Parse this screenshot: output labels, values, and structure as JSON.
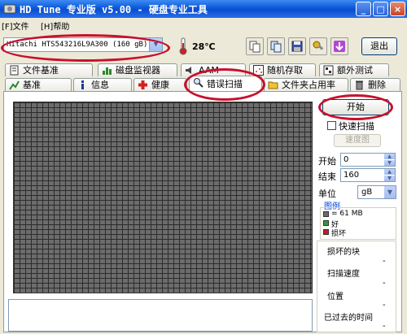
{
  "titlebar": {
    "title": "HD Tune 专业版 v5.00 - 硬盘专业工具",
    "minimize": "_",
    "maximize": "□",
    "close": "×"
  },
  "menu": {
    "file": "[F]文件",
    "help": "[H]帮助"
  },
  "toolbar": {
    "drive": "Hitachi HTS543216L9A300 (160 gB)",
    "temperature": "28℃",
    "exit_label": "退出"
  },
  "tabs_row1": [
    {
      "label": "文件基准",
      "icon": "document-icon"
    },
    {
      "label": "磁盘监视器",
      "icon": "bar-chart-icon"
    },
    {
      "label": "AAM",
      "icon": "speaker-icon"
    },
    {
      "label": "随机存取",
      "icon": "scatter-icon"
    },
    {
      "label": "额外测试",
      "icon": "tests-icon"
    }
  ],
  "tabs_row2": [
    {
      "label": "基准",
      "icon": "benchmark-icon"
    },
    {
      "label": "信息",
      "icon": "info-icon"
    },
    {
      "label": "健康",
      "icon": "health-cross-icon"
    },
    {
      "label": "错误扫描",
      "icon": "magnifier-icon",
      "active": true
    },
    {
      "label": "文件夹占用率",
      "icon": "folder-icon"
    },
    {
      "label": "删除",
      "icon": "trash-icon"
    }
  ],
  "scan": {
    "start_label": "开始",
    "quick_scan_label": "快速扫描",
    "quick_scan_checked": false,
    "speed_map_label": "速度图",
    "start_field_label": "开始",
    "start_value": "0",
    "end_field_label": "结束",
    "end_value": "160",
    "unit_label": "单位",
    "unit_value": "gB",
    "legend_title": "图例",
    "legend": [
      {
        "text": "= 61 MB",
        "color": "#6c6c6c"
      },
      {
        "text": "好",
        "color": "#2e9e2e"
      },
      {
        "text": "损坏",
        "color": "#c0202a"
      }
    ],
    "stats": [
      {
        "label": "损坏的块",
        "value": "-"
      },
      {
        "label": "扫描速度",
        "value": "-"
      },
      {
        "label": "位置",
        "value": "-"
      },
      {
        "label": "已过去的时间",
        "value": "-"
      }
    ]
  },
  "colors": {
    "titlebar": "#0a58d8",
    "annotation": "#c8102e",
    "grid_block": "#6c6c6c",
    "background": "#ece9d8"
  }
}
